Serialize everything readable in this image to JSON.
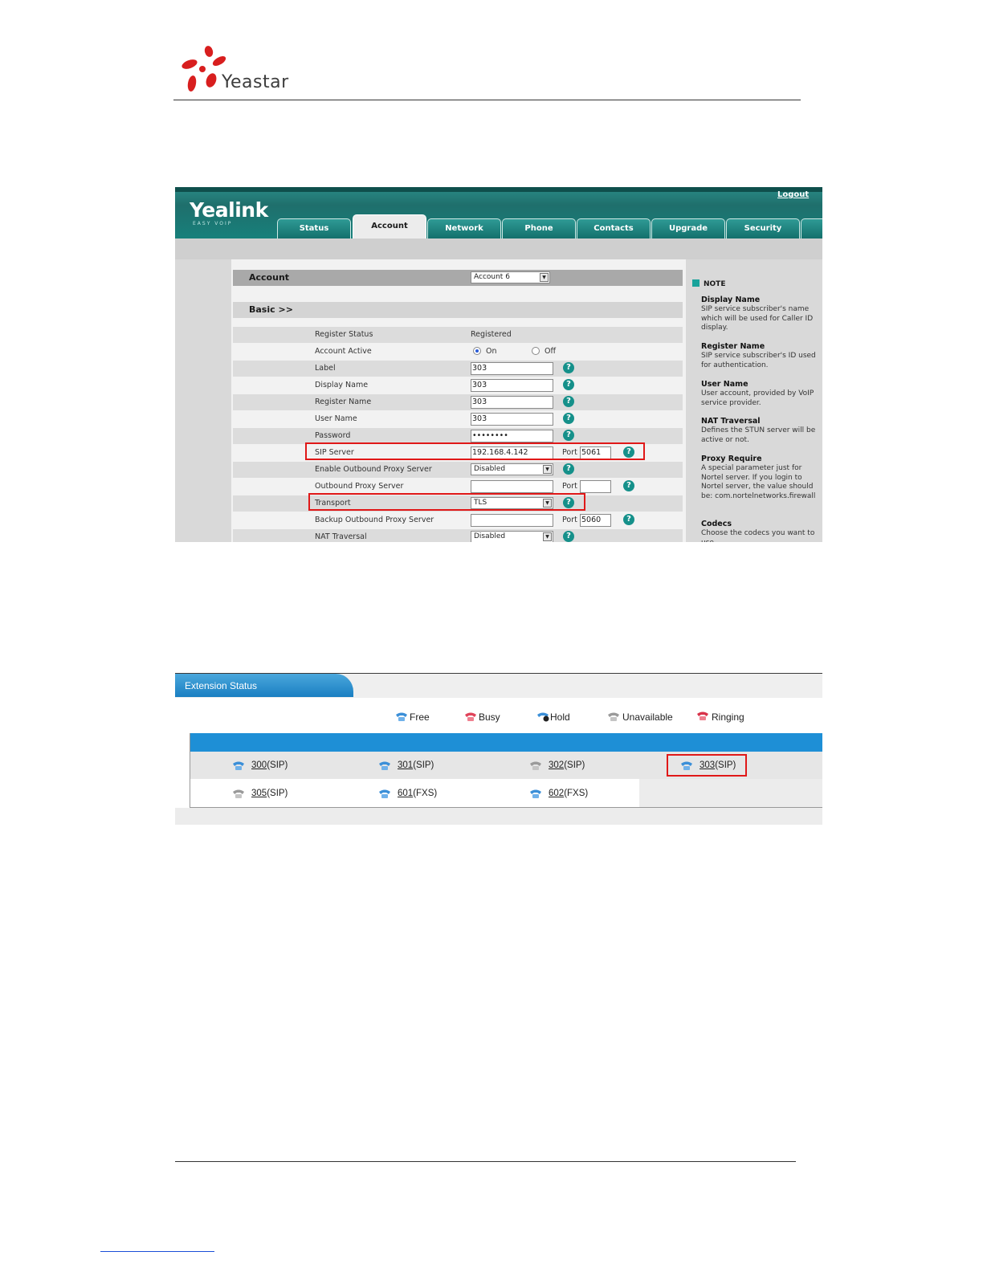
{
  "document": {
    "brand": "Yeastar",
    "colors": {
      "logo_red": "#d81e1e",
      "rule": "#333333",
      "highlight_red": "#e01818"
    }
  },
  "yealink": {
    "logo": "Yealink",
    "logo_sub": "EASY VOIP",
    "logout": "Logout",
    "tabs": [
      "Status",
      "Account",
      "Network",
      "Phone",
      "Contacts",
      "Upgrade",
      "Security"
    ],
    "active_tab": "Account",
    "account_label": "Account",
    "account_select": "Account 6",
    "basic_label": "Basic >>",
    "fields": {
      "register_status": {
        "label": "Register Status",
        "value": "Registered"
      },
      "account_active": {
        "label": "Account Active",
        "on": "On",
        "off": "Off"
      },
      "label": {
        "label": "Label",
        "value": "303"
      },
      "display_name": {
        "label": "Display Name",
        "value": "303"
      },
      "register_name": {
        "label": "Register Name",
        "value": "303"
      },
      "user_name": {
        "label": "User Name",
        "value": "303"
      },
      "password": {
        "label": "Password",
        "value": "••••••••"
      },
      "sip_server": {
        "label": "SIP Server",
        "value": "192.168.4.142",
        "port_label": "Port",
        "port": "5061"
      },
      "enable_outbound_proxy": {
        "label": "Enable Outbound Proxy Server",
        "value": "Disabled"
      },
      "outbound_proxy": {
        "label": "Outbound Proxy Server",
        "value": "",
        "port_label": "Port",
        "port": ""
      },
      "transport": {
        "label": "Transport",
        "value": "TLS"
      },
      "backup_outbound_proxy": {
        "label": "Backup Outbound Proxy Server",
        "value": "",
        "port_label": "Port",
        "port": "5060"
      },
      "nat_traversal": {
        "label": "NAT Traversal",
        "value": "Disabled"
      }
    },
    "help_glyph": "?",
    "note": {
      "heading": "NOTE",
      "items": [
        {
          "title": "Display Name",
          "body": "SIP service subscriber's name which will be used for Caller ID display."
        },
        {
          "title": "Register Name",
          "body": "SIP service subscriber's ID used for authentication."
        },
        {
          "title": "User Name",
          "body": "User account, provided by VoIP service provider."
        },
        {
          "title": "NAT Traversal",
          "body": "Defines the STUN server will be active or not."
        },
        {
          "title": "Proxy Require",
          "body": "A special parameter just for Nortel server. If you login to Nortel server, the value should be: com.nortelnetworks.firewall"
        },
        {
          "title": "Codecs",
          "body": "Choose the codecs you want to use."
        }
      ]
    },
    "colors": {
      "header": "#1f6f6c",
      "tab": "#17807b",
      "help": "#15908a"
    }
  },
  "extension_status": {
    "title": "Extension Status",
    "legend": [
      "Free",
      "Busy",
      "Hold",
      "Unavailable",
      "Ringing"
    ],
    "rows": [
      [
        {
          "num": "300",
          "type": "(SIP)",
          "state": "free"
        },
        {
          "num": "301",
          "type": "(SIP)",
          "state": "free"
        },
        {
          "num": "302",
          "type": "(SIP)",
          "state": "unavailable"
        },
        {
          "num": "303",
          "type": "(SIP)",
          "state": "free"
        }
      ],
      [
        {
          "num": "305",
          "type": "(SIP)",
          "state": "unavailable"
        },
        {
          "num": "601",
          "type": "(FXS)",
          "state": "free"
        },
        {
          "num": "602",
          "type": "(FXS)",
          "state": "free"
        }
      ]
    ],
    "colors": {
      "tab": "#1a7fc2",
      "header_row": "#1e8fd6",
      "free": "#3b8fd8",
      "busy": "#e0435a",
      "unavailable": "#9a9a9a",
      "ringing": "#d8334a"
    }
  }
}
